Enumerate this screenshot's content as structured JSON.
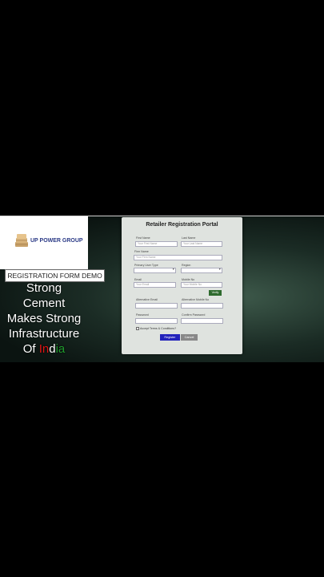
{
  "brand": {
    "name": "UP POWER GROUP"
  },
  "demo_label": "REGISTRATION FORM DEMO",
  "tagline": {
    "line1": "Strong",
    "line2": "Cement",
    "line3": "Makes Strong",
    "line4": "Infrastructure",
    "line5_prefix": "Of ",
    "line5_red": "In",
    "line5_mid": "d",
    "line5_green": "ia"
  },
  "form": {
    "title": "Retailer Registration Portal",
    "first_name": {
      "label": "First Name",
      "placeholder": "Your First Name"
    },
    "last_name": {
      "label": "Last Name",
      "placeholder": "Your Last Name"
    },
    "firm_name": {
      "label": "Firm Name",
      "placeholder": "Your Firm Name"
    },
    "primary_user": {
      "label": "Primary User Type",
      "value": ""
    },
    "region": {
      "label": "Region",
      "value": ""
    },
    "email": {
      "label": "Email",
      "placeholder": "Your Email"
    },
    "mobile": {
      "label": "Mobile No",
      "placeholder": "Your Mobile No"
    },
    "verify_label": "Verify",
    "alt_email": {
      "label": "Alternative Email"
    },
    "alt_mobile": {
      "label": "Alternative Mobile No"
    },
    "password": {
      "label": "Password"
    },
    "confirm_password": {
      "label": "Confirm Password"
    },
    "terms_label": "Accept Terms & Conditions?",
    "register_label": "Register",
    "cancel_label": "Cancel"
  }
}
